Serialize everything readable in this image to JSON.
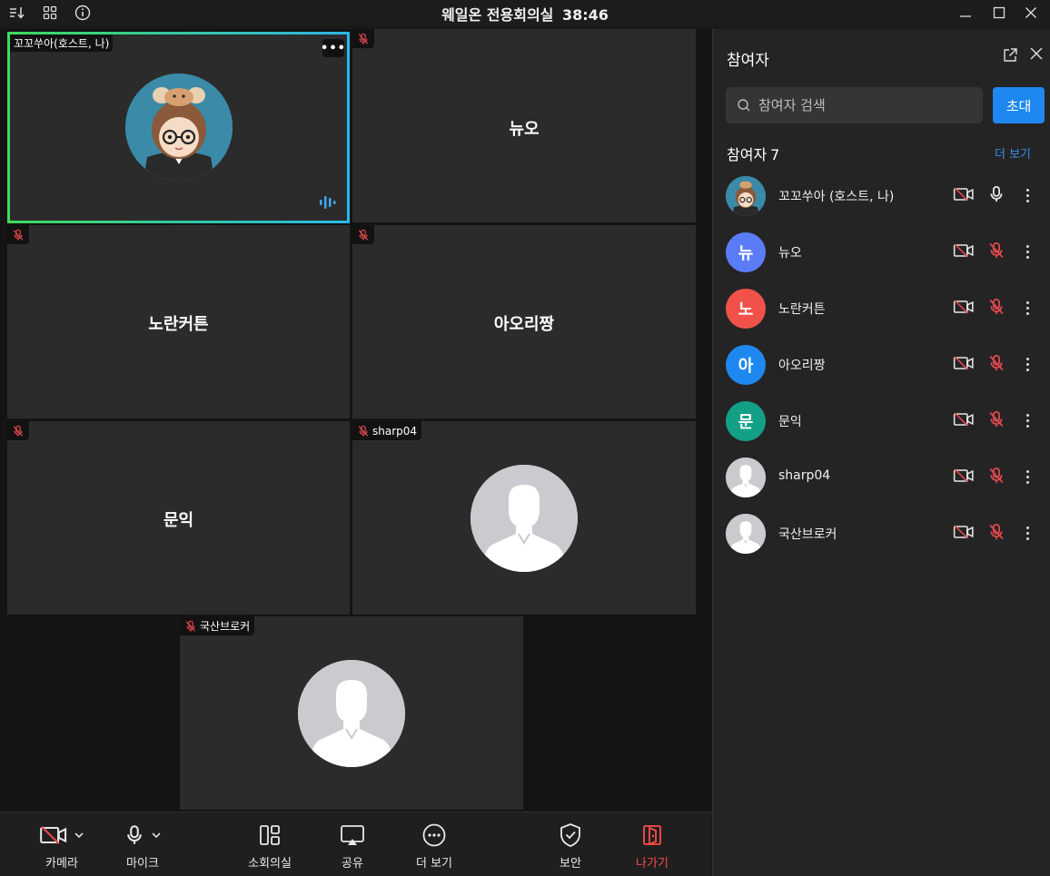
{
  "window": {
    "title": "웨일온 전용회의실",
    "timer": "38:46",
    "icons": [
      "sort-icon",
      "grid-layout-icon",
      "info-icon",
      "minimize-icon",
      "maximize-icon",
      "close-icon"
    ]
  },
  "tiles": [
    {
      "name": "꼬꼬쑤아(호스트, 나)",
      "active": true,
      "mic_muted": false
    },
    {
      "name": "뉴오",
      "mic_muted": true
    },
    {
      "name": "노란커튼",
      "mic_muted": true
    },
    {
      "name": "아오리짱",
      "mic_muted": true
    },
    {
      "name": "문익",
      "mic_muted": true
    },
    {
      "name": "sharp04",
      "mic_muted": true
    },
    {
      "name": "국산브로커",
      "mic_muted": true
    }
  ],
  "toolbar": {
    "camera": "카메라",
    "mic": "마이크",
    "breakout": "소회의실",
    "share": "공유",
    "more": "더 보기",
    "security": "보안",
    "leave": "나가기",
    "leave_color": "#ff4b4b"
  },
  "panel": {
    "title": "참여자",
    "search_placeholder": "참여자 검색",
    "invite": "초대",
    "count_label": "참여자",
    "count": "7",
    "see_more": "더 보기",
    "accent": "#1e88f0",
    "participants": [
      {
        "name": "꼬꼬쑤아  (호스트, 나)",
        "initial": "",
        "color": "#3a8aa8",
        "mic_muted": false
      },
      {
        "name": "뉴오",
        "initial": "뉴",
        "color": "#5b7cf6",
        "mic_muted": true
      },
      {
        "name": "노란커튼",
        "initial": "노",
        "color": "#f0524a",
        "mic_muted": true
      },
      {
        "name": "아오리짱",
        "initial": "아",
        "color": "#1e88f0",
        "mic_muted": true
      },
      {
        "name": "문익",
        "initial": "문",
        "color": "#13a086",
        "mic_muted": true
      },
      {
        "name": "sharp04",
        "initial": "",
        "color": "#c9cbcf",
        "mic_muted": true
      },
      {
        "name": "국산브로커",
        "initial": "",
        "color": "#c9cbcf",
        "mic_muted": true
      }
    ]
  }
}
